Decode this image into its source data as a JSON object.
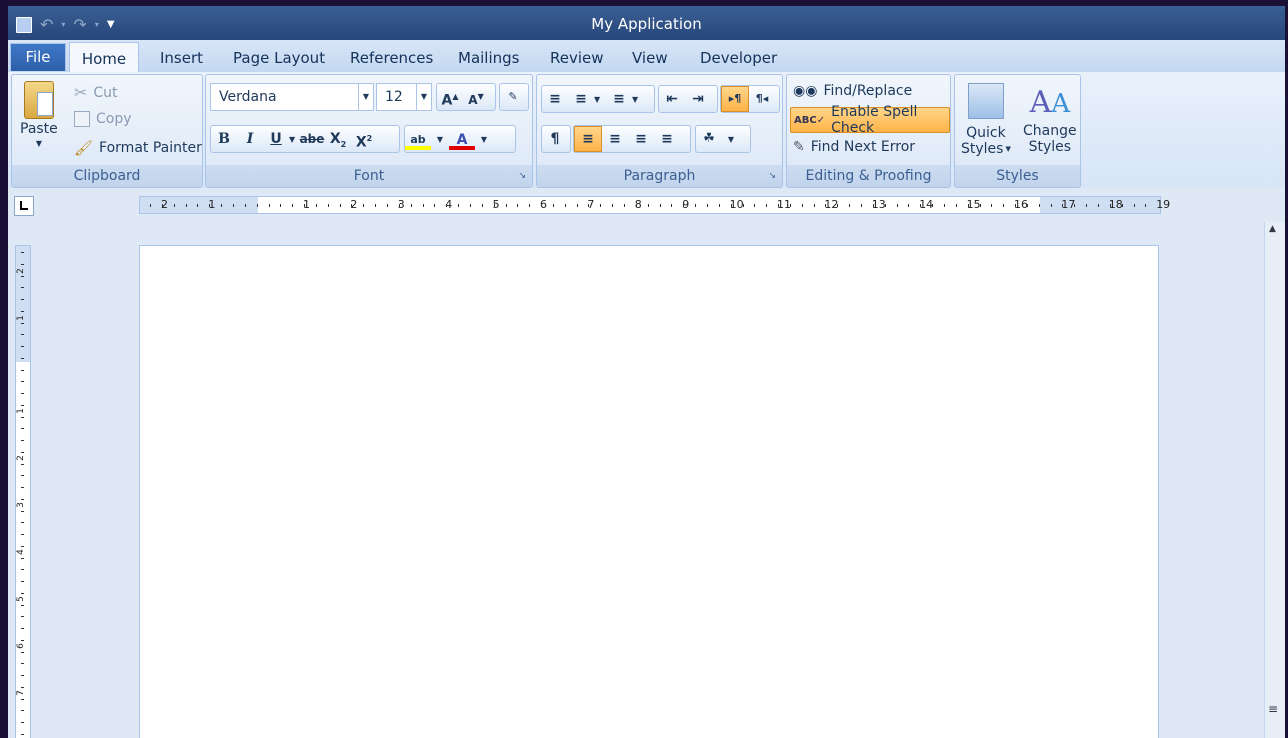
{
  "app": {
    "title": "My Application"
  },
  "tabs": {
    "file": "File",
    "home": "Home",
    "insert": "Insert",
    "page_layout": "Page Layout",
    "references": "References",
    "mailings": "Mailings",
    "review": "Review",
    "view": "View",
    "developer": "Developer"
  },
  "clipboard": {
    "label": "Clipboard",
    "paste": "Paste",
    "cut": "Cut",
    "copy": "Copy",
    "format_painter": "Format Painter"
  },
  "font": {
    "label": "Font",
    "family": "Verdana",
    "size": "12"
  },
  "paragraph": {
    "label": "Paragraph"
  },
  "editing": {
    "label": "Editing & Proofing",
    "find_replace": "Find/Replace",
    "spell_check": "Enable Spell Check",
    "find_next_error": "Find Next Error"
  },
  "styles": {
    "label": "Styles",
    "quick_styles_1": "Quick",
    "quick_styles_2": "Styles",
    "change_styles_1": "Change",
    "change_styles_2": "Styles"
  },
  "ruler": {
    "h_left": [
      "2",
      "1"
    ],
    "h_main": [
      "1",
      "2",
      "3",
      "4",
      "5",
      "6",
      "7",
      "8",
      "9",
      "10",
      "11",
      "12",
      "13",
      "14",
      "15",
      "16",
      "17",
      "18",
      "19"
    ],
    "v_top": [
      "2",
      "1"
    ],
    "v_main": [
      "1",
      "2",
      "3",
      "4",
      "5",
      "6",
      "7"
    ]
  },
  "colors": {
    "accent": "#2c5fa8",
    "highlight": "#ffb347",
    "highlighter_yellow": "#ffff00",
    "font_red": "#e00000"
  },
  "icons": [
    "save-icon",
    "undo-icon",
    "redo-icon",
    "customize-qat-icon",
    "paste-icon",
    "cut-icon",
    "copy-icon",
    "format-painter-icon",
    "grow-font-icon",
    "shrink-font-icon",
    "clear-format-icon",
    "bold-icon",
    "italic-icon",
    "underline-icon",
    "strikethrough-icon",
    "subscript-icon",
    "superscript-icon",
    "highlight-icon",
    "font-color-icon",
    "bullets-icon",
    "numbering-icon",
    "multilevel-list-icon",
    "decrease-indent-icon",
    "increase-indent-icon",
    "ltr-icon",
    "rtl-icon",
    "show-marks-icon",
    "align-left-icon",
    "align-center-icon",
    "align-right-icon",
    "justify-icon",
    "shading-icon",
    "binoculars-icon",
    "spell-check-icon",
    "find-next-error-icon",
    "quick-styles-icon",
    "change-styles-icon",
    "tab-selector-icon",
    "scroll-up-icon",
    "split-icon"
  ]
}
